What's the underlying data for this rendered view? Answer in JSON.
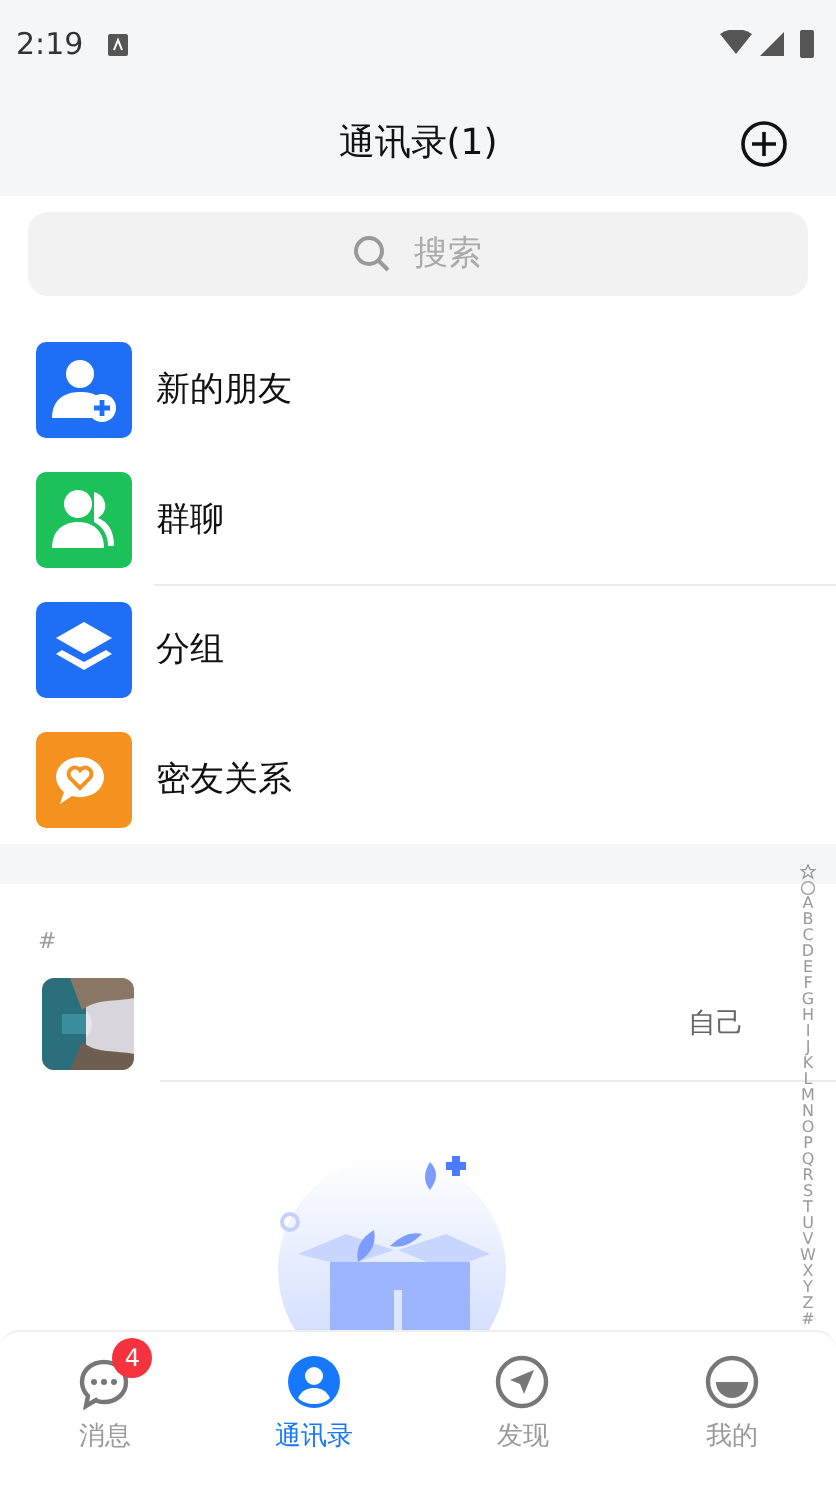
{
  "status_bar": {
    "time": "2:19"
  },
  "header": {
    "title": "通讯录(1)"
  },
  "search": {
    "placeholder": "搜索"
  },
  "entries": [
    {
      "label": "新的朋友",
      "kind": "new-friend",
      "color": "#1f6ff6"
    },
    {
      "label": "群聊",
      "kind": "group-chat",
      "color": "#1cc15a"
    },
    {
      "label": "分组",
      "kind": "groups",
      "color": "#1f6ff6"
    },
    {
      "label": "密友关系",
      "kind": "close-friends",
      "color": "#f5921f"
    }
  ],
  "contacts": [
    {
      "letter": "#",
      "items": [
        {
          "tag": "自己"
        }
      ]
    }
  ],
  "index_bar": [
    "A",
    "B",
    "C",
    "D",
    "E",
    "F",
    "G",
    "H",
    "I",
    "J",
    "K",
    "L",
    "M",
    "N",
    "O",
    "P",
    "Q",
    "R",
    "S",
    "T",
    "U",
    "V",
    "W",
    "X",
    "Y",
    "Z",
    "#"
  ],
  "tabs": [
    {
      "label": "消息",
      "kind": "chat",
      "selected": false,
      "badge": "4"
    },
    {
      "label": "通讯录",
      "kind": "contacts",
      "selected": true
    },
    {
      "label": "发现",
      "kind": "discover",
      "selected": false
    },
    {
      "label": "我的",
      "kind": "me",
      "selected": false
    }
  ]
}
